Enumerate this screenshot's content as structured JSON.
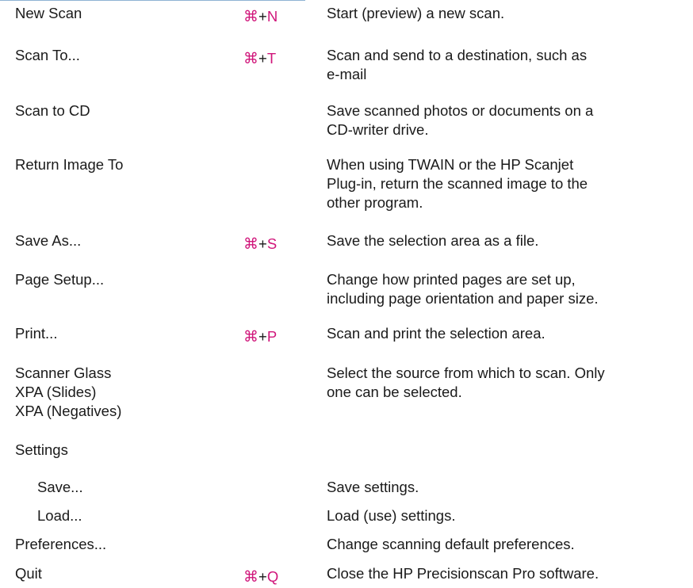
{
  "rows": [
    {
      "command": [
        "New Scan"
      ],
      "shortcut": {
        "symbol": "⌘",
        "plus": "+",
        "key": "N"
      },
      "description": [
        "Start (preview) a new scan."
      ]
    },
    {
      "command": [
        "Scan To..."
      ],
      "shortcut": {
        "symbol": "⌘",
        "plus": "+",
        "key": "T"
      },
      "description": [
        "Scan and send to a destination, such as",
        "e-mail"
      ]
    },
    {
      "command": [
        "Scan to CD"
      ],
      "description": [
        "Save scanned photos or documents on a",
        "CD-writer drive."
      ]
    },
    {
      "command": [
        "Return Image To"
      ],
      "description": [
        "When using TWAIN or the HP Scanjet",
        "Plug-in, return the scanned image to the",
        "other program."
      ]
    },
    {
      "command": [
        "Save As..."
      ],
      "shortcut": {
        "symbol": "⌘",
        "plus": "+",
        "key": "S"
      },
      "description": [
        "Save the selection area as a file."
      ]
    },
    {
      "command": [
        "Page Setup..."
      ],
      "description": [
        "Change how printed pages are set up,",
        "including page orientation and paper size."
      ]
    },
    {
      "command": [
        "Print..."
      ],
      "shortcut": {
        "symbol": "⌘",
        "plus": "+",
        "key": "P"
      },
      "description": [
        "Scan and print the selection area."
      ]
    },
    {
      "command": [
        "Scanner Glass",
        "XPA (Slides)",
        "XPA (Negatives)"
      ],
      "description": [
        "Select the source from which to scan. Only",
        "one can be selected."
      ]
    },
    {
      "command": [
        "Settings"
      ],
      "description": []
    },
    {
      "command": [
        "Save..."
      ],
      "sub": true,
      "description": [
        "Save settings."
      ]
    },
    {
      "command": [
        "Load..."
      ],
      "sub": true,
      "description": [
        "Load (use) settings."
      ]
    },
    {
      "command": [
        "Preferences..."
      ],
      "description": [
        "Change scanning default preferences."
      ]
    },
    {
      "command": [
        "Quit"
      ],
      "shortcut": {
        "symbol": "⌘",
        "plus": "+",
        "key": "Q"
      },
      "description": [
        "Close the HP Precisionscan Pro software."
      ]
    }
  ],
  "colors": {
    "shortcut_accent": "#d0157a",
    "top_rule": "#8fb3d4"
  }
}
